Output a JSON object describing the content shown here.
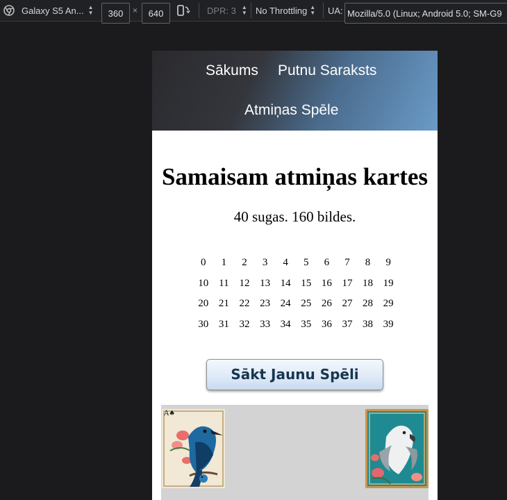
{
  "devtools": {
    "device": "Galaxy S5 An...",
    "width": "360",
    "times": "×",
    "height": "640",
    "dpr": "DPR: 3",
    "throttling": "No Throttling",
    "ua_label": "UA:",
    "ua_value": "Mozilla/5.0 (Linux; Android 5.0; SM-G9",
    "icons": [
      "chrome-icon",
      "caret-icon",
      "rotate-icon"
    ]
  },
  "site": {
    "nav": {
      "home": "Sākums",
      "birds": "Putnu Saraksts",
      "memory": "Atmiņas Spēle"
    },
    "title": "Samaisam atmiņas kartes",
    "subtitle": "40 sugas. 160 bildes.",
    "numbers": [
      "0",
      "1",
      "2",
      "3",
      "4",
      "5",
      "6",
      "7",
      "8",
      "9",
      "10",
      "11",
      "12",
      "13",
      "14",
      "15",
      "16",
      "17",
      "18",
      "19",
      "20",
      "21",
      "22",
      "23",
      "24",
      "25",
      "26",
      "27",
      "28",
      "29",
      "30",
      "31",
      "32",
      "33",
      "34",
      "35",
      "36",
      "37",
      "38",
      "39"
    ],
    "start_button": "Sākt Jaunu Spēli",
    "cards": [
      {
        "name": "blue-bird-card",
        "corner": "A♠"
      },
      {
        "name": "white-bird-card",
        "corner": ""
      }
    ],
    "colors": {
      "nav_dark": "#2a2a2e",
      "nav_blue": "#6a9bc8",
      "button_text": "#17364f",
      "card_area": "#d3d3d3"
    }
  }
}
